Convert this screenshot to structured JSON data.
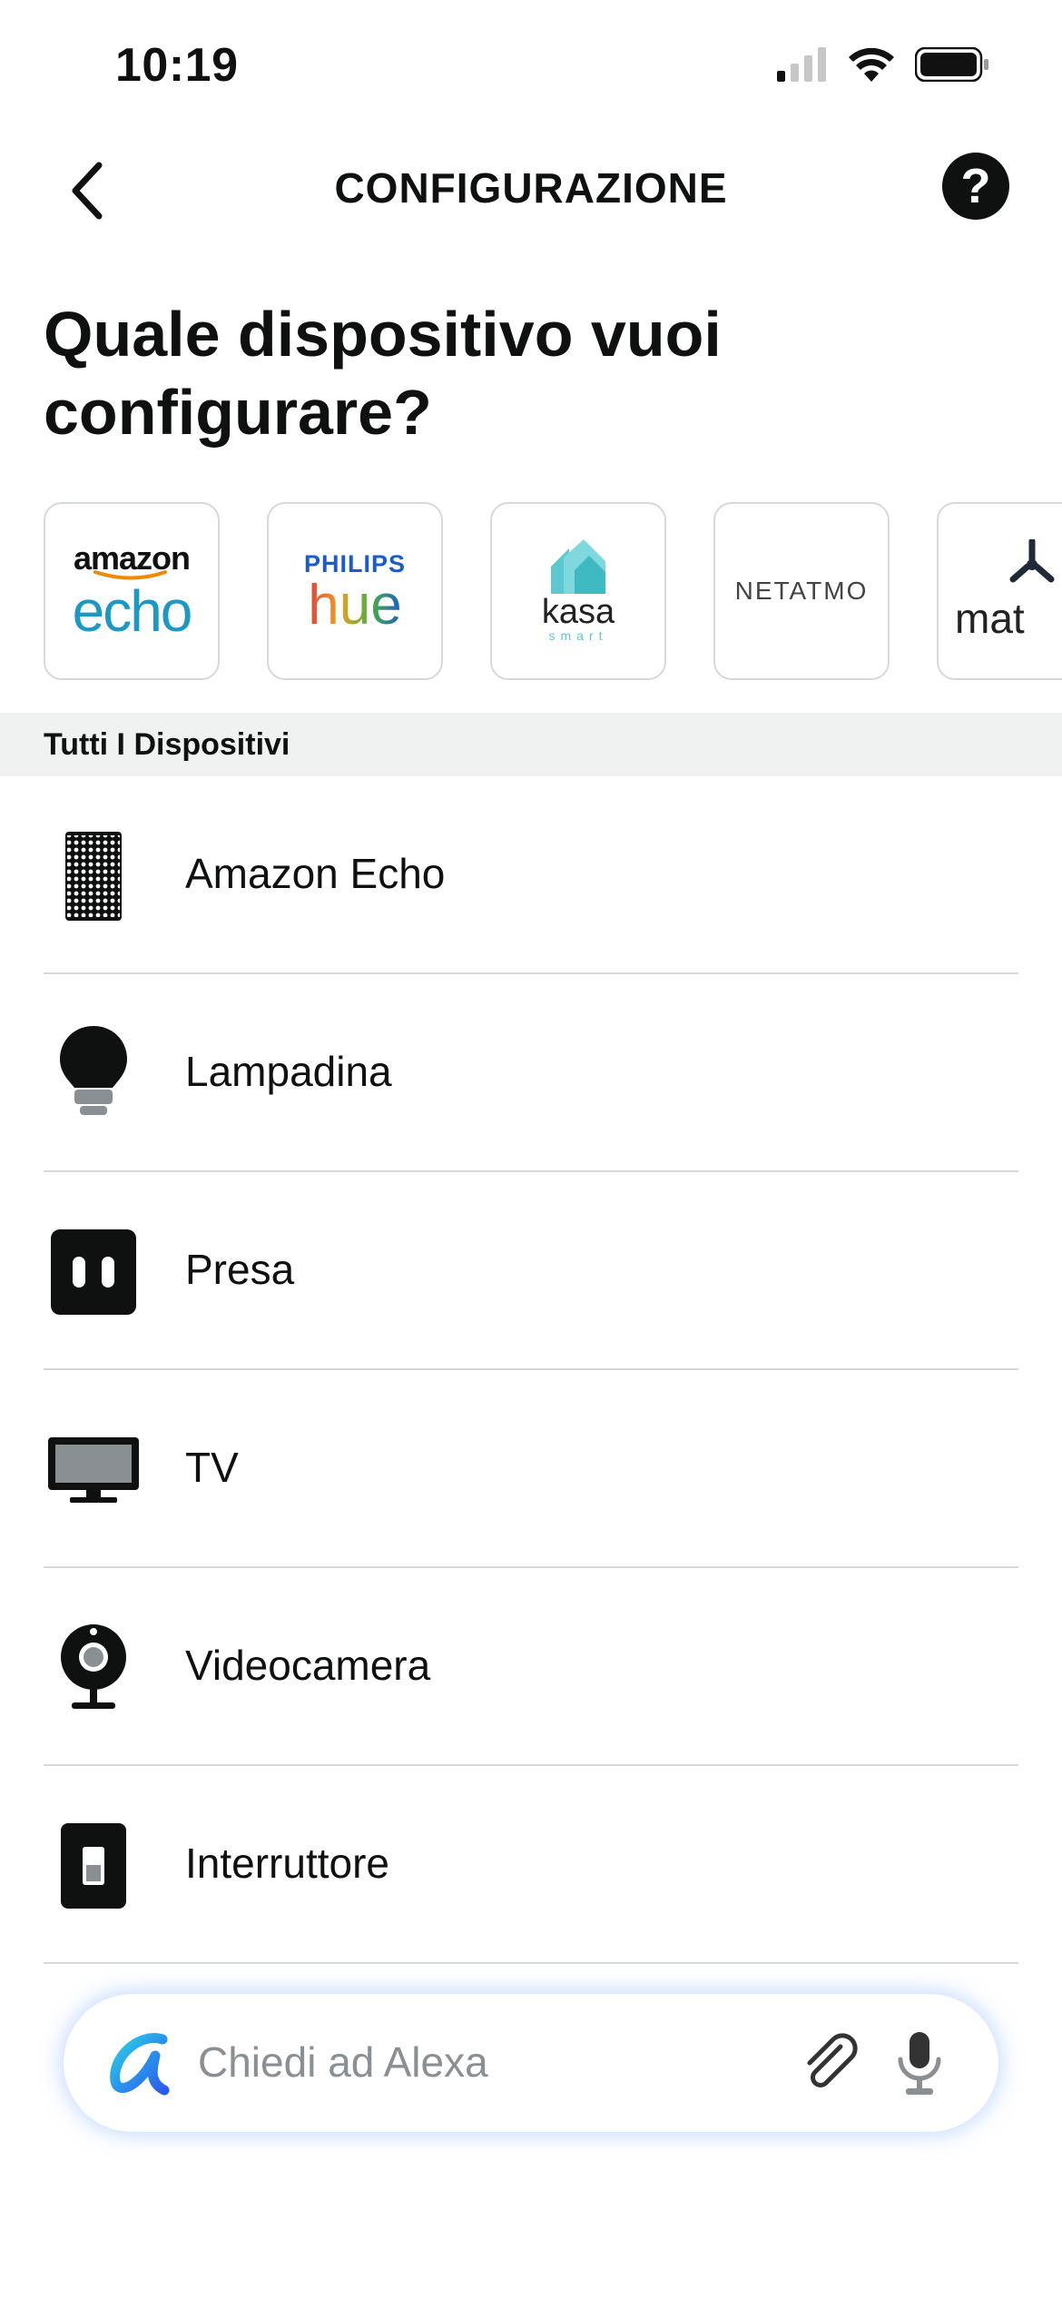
{
  "status": {
    "time": "10:19"
  },
  "header": {
    "title": "CONFIGURAZIONE",
    "back_icon": "chevron-left-icon",
    "help_icon": "question-icon",
    "help_label": "?"
  },
  "question": "Quale dispositivo vuoi configurare?",
  "brands": [
    {
      "line1": "amazon",
      "line2": "echo"
    },
    {
      "line1": "PHILIPS",
      "line2": "hue"
    },
    {
      "line1": "kasa",
      "line2": "smart"
    },
    {
      "line1": "NETATMO"
    },
    {
      "line1": "mat"
    }
  ],
  "section": {
    "label": "Tutti I Dispositivi"
  },
  "devices": [
    {
      "label": "Amazon Echo",
      "icon": "speaker-icon"
    },
    {
      "label": "Lampadina",
      "icon": "bulb-icon"
    },
    {
      "label": "Presa",
      "icon": "plug-icon"
    },
    {
      "label": "TV",
      "icon": "tv-icon"
    },
    {
      "label": "Videocamera",
      "icon": "camera-icon"
    },
    {
      "label": "Interruttore",
      "icon": "switch-icon"
    }
  ],
  "alexa": {
    "placeholder": "Chiedi ad Alexa"
  },
  "colors": {
    "accent": "#1a98c6",
    "kasa": "#5bc9cf",
    "philips": "#1b5ccc"
  }
}
